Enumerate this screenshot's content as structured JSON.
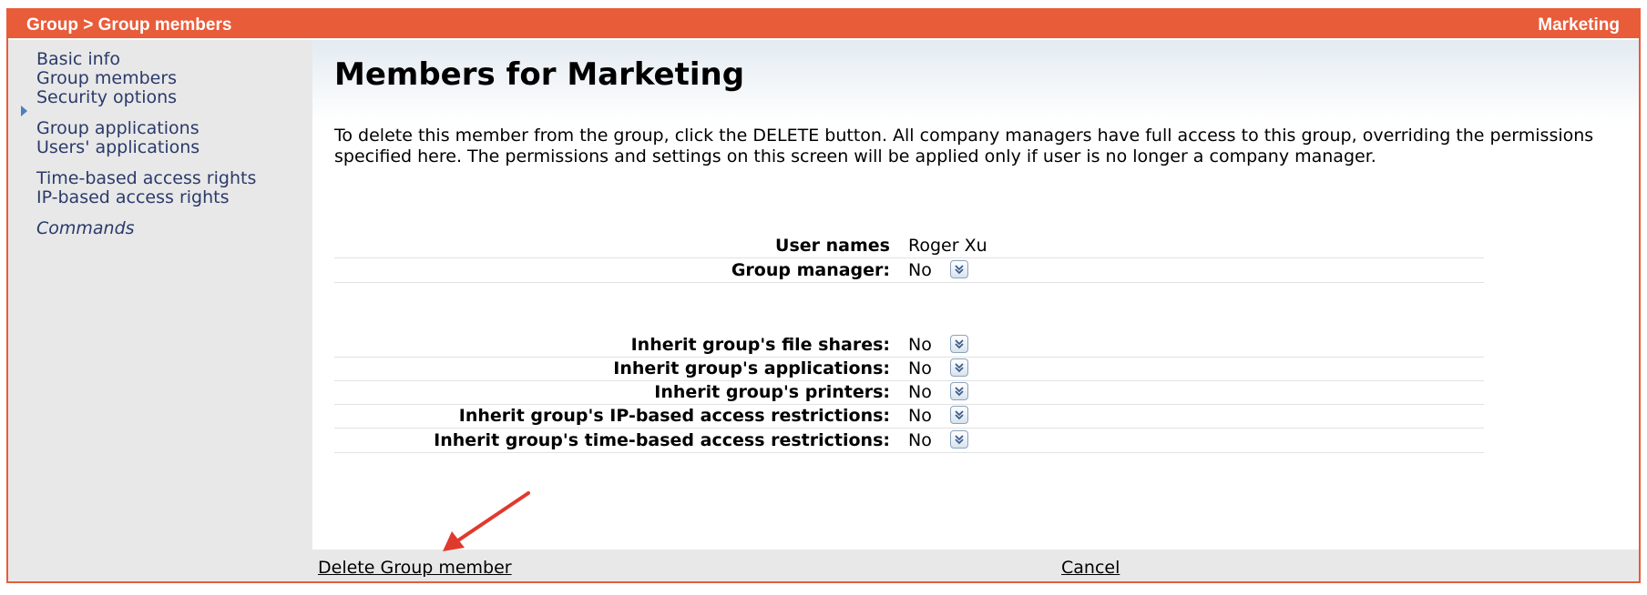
{
  "header": {
    "breadcrumb": "Group > Group members",
    "group_name": "Marketing"
  },
  "sidebar": {
    "items": [
      {
        "label": "Basic info"
      },
      {
        "label": "Group members",
        "selected": true
      },
      {
        "label": "Security options"
      },
      {
        "label": "Group applications"
      },
      {
        "label": "Users' applications"
      },
      {
        "label": "Time-based access rights"
      },
      {
        "label": "IP-based access rights"
      },
      {
        "label": "Commands"
      }
    ]
  },
  "main": {
    "title": "Members for Marketing",
    "description": "To delete this member from the group, click the DELETE button. All company managers have full access to this group, overriding the permissions specified here. The permissions and settings on this screen will be applied only if user is no longer a company manager.",
    "user_name_label": "User names",
    "user_name_value": "Roger Xu",
    "group_manager_label": "Group manager:",
    "group_manager_value": "No",
    "inherit": [
      {
        "label": "Inherit group's file shares:",
        "value": "No"
      },
      {
        "label": "Inherit group's applications:",
        "value": "No"
      },
      {
        "label": "Inherit group's printers:",
        "value": "No"
      },
      {
        "label": "Inherit group's IP-based access restrictions:",
        "value": "No"
      },
      {
        "label": "Inherit group's time-based access restrictions:",
        "value": "No"
      }
    ]
  },
  "footer": {
    "delete_label": "Delete Group member",
    "cancel_label": "Cancel"
  },
  "icons": {
    "dropdown": "double-chevron-down-icon",
    "annotation": "red-arrow-icon"
  },
  "colors": {
    "accent": "#e85c3a",
    "nav_text": "#2b3a6a",
    "annotation_arrow": "#e03a2e"
  }
}
